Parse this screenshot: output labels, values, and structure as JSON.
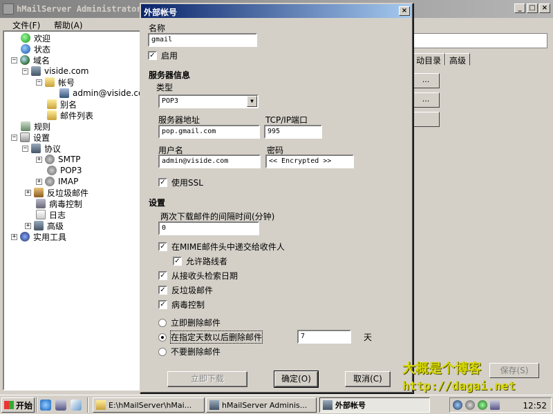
{
  "main_window": {
    "title": "hMailServer Administrator",
    "menu": [
      "文件(F)",
      "帮助(A)"
    ],
    "tree": [
      {
        "label": "欢迎"
      },
      {
        "label": "状态"
      },
      {
        "label": "域名"
      },
      {
        "label": "viside.com"
      },
      {
        "label": "帐号"
      },
      {
        "label": "admin@viside.com"
      },
      {
        "label": "别名"
      },
      {
        "label": "邮件列表"
      },
      {
        "label": "规则"
      },
      {
        "label": "设置"
      },
      {
        "label": "协议"
      },
      {
        "label": "SMTP"
      },
      {
        "label": "POP3"
      },
      {
        "label": "IMAP"
      },
      {
        "label": "反垃圾邮件"
      },
      {
        "label": "病毒控制"
      },
      {
        "label": "日志"
      },
      {
        "label": "高级"
      },
      {
        "label": "实用工具"
      }
    ],
    "right_pane": {
      "tabs": [
        "动目录",
        "高级"
      ],
      "button_ellipsis": "...",
      "save_label": "保存(S)"
    }
  },
  "dialog": {
    "title": "外部帐号",
    "name_label": "名称",
    "name_value": "gmail",
    "enabled_label": "启用",
    "server_info_heading": "服务器信息",
    "type_label": "类型",
    "type_value": "POP3",
    "server_address_label": "服务器地址",
    "server_address_value": "pop.gmail.com",
    "port_label": "TCP/IP端口",
    "port_value": "995",
    "username_label": "用户名",
    "username_value": "admin@viside.com",
    "password_label": "密码",
    "password_value": "<< Encrypted >>",
    "use_ssl_label": "使用SSL",
    "settings_heading": "设置",
    "interval_label": "两次下载邮件的间隔时间(分钟)",
    "interval_value": "0",
    "deliver_mime_label": "在MIME邮件头中递交给收件人",
    "allow_route_label": "允许路线者",
    "retrieve_date_label": "从接收头检索日期",
    "antispam_label": "反垃圾邮件",
    "antivirus_label": "病毒控制",
    "delete_immediately_label": "立即删除邮件",
    "delete_after_days_label": "在指定天数以后删除邮件",
    "days_value": "7",
    "days_unit": "天",
    "no_delete_label": "不要删除邮件",
    "download_now_label": "立即下载",
    "ok_label": "确定(O)",
    "cancel_label": "取消(C)"
  },
  "watermark": {
    "line1": "大概是个博客",
    "line2": "http://dagai.net"
  },
  "taskbar": {
    "start_label": "开始",
    "tasks": [
      "E:\\hMailServer\\hMai...",
      "hMailServer Adminis...",
      "外部帐号"
    ],
    "clock": "12:52"
  }
}
